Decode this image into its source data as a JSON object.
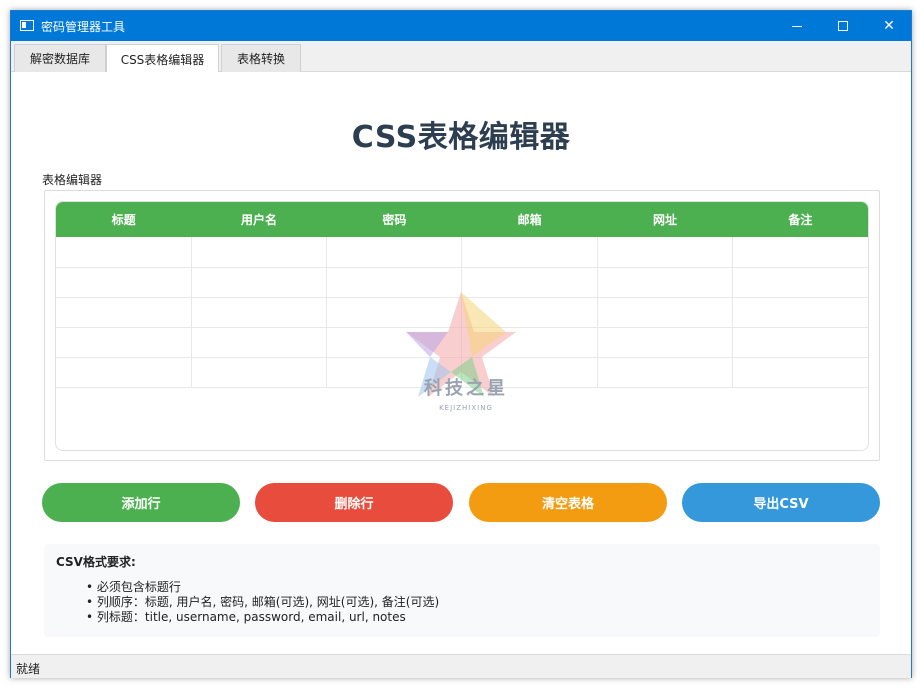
{
  "window": {
    "title": "密码管理器工具",
    "controls": {
      "minimize": "minimize",
      "maximize": "maximize",
      "close": "✕"
    }
  },
  "tabs": [
    {
      "label": "解密数据库",
      "active": false
    },
    {
      "label": "CSS表格编辑器",
      "active": true
    },
    {
      "label": "表格转换",
      "active": false
    }
  ],
  "main": {
    "page_title": "CSS表格编辑器",
    "group_label": "表格编辑器",
    "table": {
      "headers": [
        "标题",
        "用户名",
        "密码",
        "邮箱",
        "网址",
        "备注"
      ],
      "header_color": "#4caf50",
      "rows": [
        [
          "",
          "",
          "",
          "",
          "",
          ""
        ],
        [
          "",
          "",
          "",
          "",
          "",
          ""
        ],
        [
          "",
          "",
          "",
          "",
          "",
          ""
        ],
        [
          "",
          "",
          "",
          "",
          "",
          ""
        ],
        [
          "",
          "",
          "",
          "",
          "",
          ""
        ]
      ]
    },
    "buttons": {
      "add": {
        "label": "添加行",
        "color": "#4caf50"
      },
      "delete": {
        "label": "删除行",
        "color": "#e74c3c"
      },
      "clear": {
        "label": "清空表格",
        "color": "#f39c12"
      },
      "export": {
        "label": "导出CSV",
        "color": "#3498db"
      }
    },
    "csv_info": {
      "title": "CSV格式要求:",
      "items": [
        "必须包含标题行",
        "列顺序：标题, 用户名, 密码, 邮箱(可选), 网址(可选), 备注(可选)",
        "列标题：title, username, password, email, url, notes"
      ]
    }
  },
  "watermark": {
    "text": "科技之星",
    "subtext": "KEJIZHIXING"
  },
  "statusbar": {
    "text": "就绪"
  }
}
